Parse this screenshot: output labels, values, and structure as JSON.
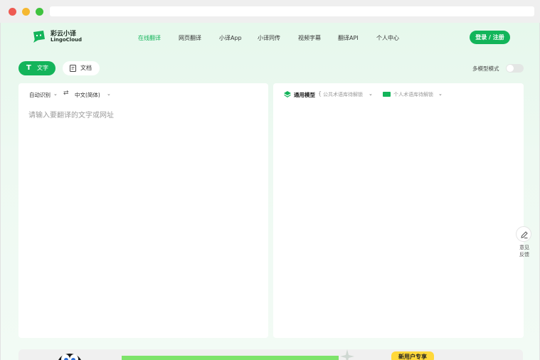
{
  "brand": {
    "name_cn": "彩云小译",
    "name_en": "LingoCloud",
    "accent": "#13b45a"
  },
  "nav": {
    "items": [
      {
        "label": "在线翻译",
        "active": true
      },
      {
        "label": "网页翻译",
        "active": false
      },
      {
        "label": "小译App",
        "active": false
      },
      {
        "label": "小译同传",
        "active": false
      },
      {
        "label": "视频字幕",
        "active": false
      },
      {
        "label": "翻译API",
        "active": false
      },
      {
        "label": "个人中心",
        "active": false
      }
    ],
    "login_label": "登录 / 注册"
  },
  "mode_tabs": {
    "text_label": "文字",
    "doc_label": "文档",
    "active": "text"
  },
  "multi_model": {
    "label": "多模型模式",
    "enabled": false
  },
  "source_panel": {
    "source_lang": "自动识别",
    "target_lang": "中文(简体)",
    "placeholder": "请输入要翻译的文字或网址"
  },
  "target_panel": {
    "model_label": "通用模型",
    "brace": "{",
    "public_term": "公共术语库待解锁",
    "personal_term": "个人术语库待解锁"
  },
  "feedback": {
    "line1": "意见",
    "line2": "反馈"
  },
  "banner": {
    "badge": "新用户专享"
  }
}
